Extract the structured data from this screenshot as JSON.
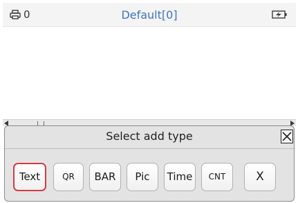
{
  "status_bar": {
    "printer_icon": "printer-icon",
    "print_count": "0",
    "title": "Default[0]",
    "battery_icon": "battery-charging-icon"
  },
  "dialog": {
    "title": "Select add type",
    "close_icon": "close-icon",
    "buttons": [
      {
        "label": "Text",
        "selected": true
      },
      {
        "label": "QR",
        "selected": false
      },
      {
        "label": "BAR",
        "selected": false
      },
      {
        "label": "Pic",
        "selected": false
      },
      {
        "label": "Time",
        "selected": false
      },
      {
        "label": "CNT",
        "selected": false
      },
      {
        "label": "X",
        "selected": false
      }
    ]
  },
  "colors": {
    "title_blue": "#3f76b8",
    "selected_border": "#d23b46",
    "dialog_bg": "#e3e3e3"
  }
}
